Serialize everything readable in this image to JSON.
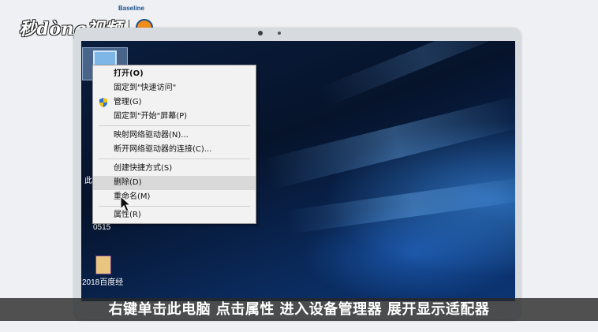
{
  "watermark": {
    "brand_text": "秒dòng视频",
    "partner_text": "Baseline"
  },
  "desktop": {
    "icons": [
      {
        "label": "0515",
        "icon": "folder-icon"
      },
      {
        "label": "2018百度经",
        "icon": "archive-icon"
      }
    ],
    "partial_label": "此"
  },
  "context_menu": {
    "items": [
      {
        "label": "打开(O)",
        "bold": true
      },
      {
        "label": "固定到\"快速访问\""
      },
      {
        "label": "管理(G)",
        "icon": "shield-icon"
      },
      {
        "label": "固定到\"开始\"屏幕(P)"
      },
      {
        "label": "映射网络驱动器(N)..."
      },
      {
        "label": "断开网络驱动器的连接(C)..."
      },
      {
        "label": "创建快捷方式(S)"
      },
      {
        "label": "删除(D)",
        "highlighted": true
      },
      {
        "label": "重命名(M)"
      },
      {
        "label": "属性(R)"
      }
    ]
  },
  "caption": {
    "text": "右键单击此电脑 点击属性 进入设备管理器 展开显示适配器"
  },
  "colors": {
    "menu_highlight": "#d9d9d9",
    "desktop_bg": "#0a1d3d",
    "caption_bg": "#282828"
  }
}
